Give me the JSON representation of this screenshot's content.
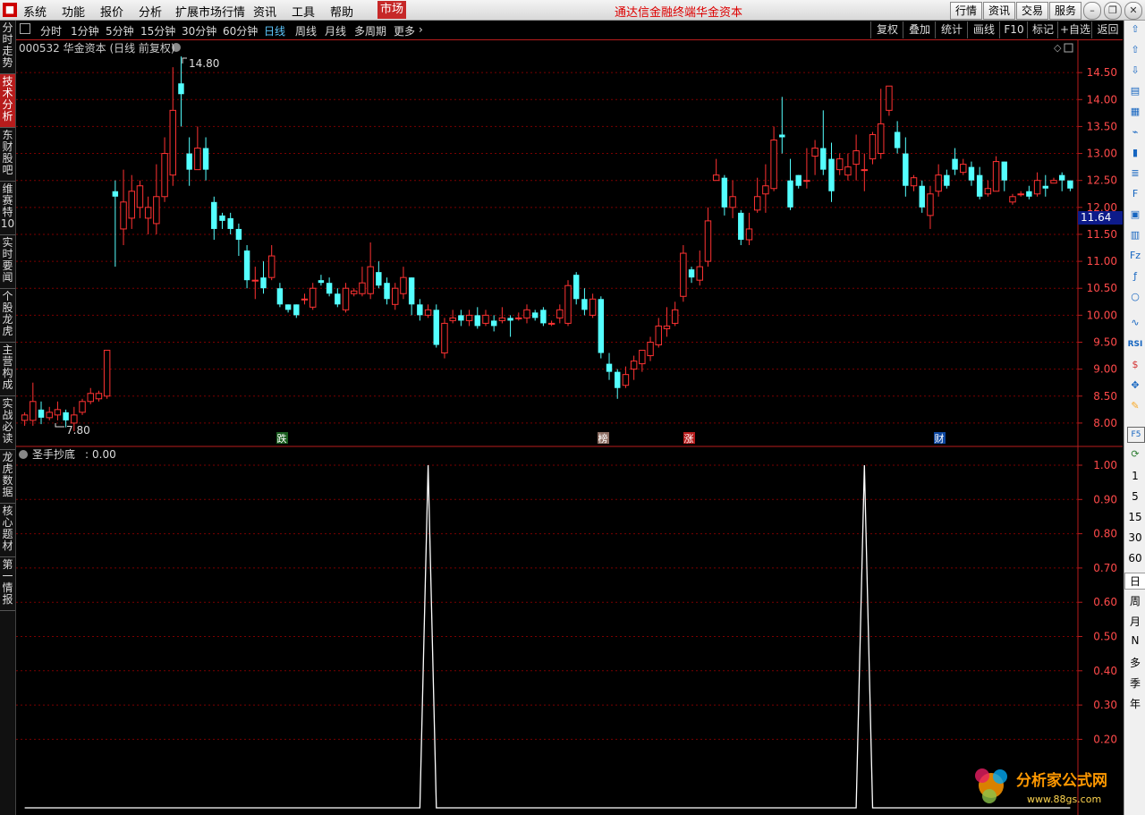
{
  "menubar": {
    "items": [
      "系统",
      "功能",
      "报价",
      "分析",
      "扩展市场行情",
      "资讯",
      "工具",
      "帮助"
    ],
    "market": "市场",
    "title1": "通达信金融终端",
    "title2": "华金资本",
    "buttons": [
      "行情",
      "资讯",
      "交易",
      "服务"
    ]
  },
  "sidebar_left": [
    "分时走势",
    "技术分析",
    "东财股吧",
    "维赛特10",
    "实时要闻",
    "个股龙虎",
    "主营构成",
    "实战必读",
    "龙虎数据",
    "核心题材",
    "第一情报"
  ],
  "sidebar_right_periods": [
    "1",
    "5",
    "15",
    "30",
    "60",
    "日",
    "周",
    "月",
    "N",
    "多",
    "季",
    "年"
  ],
  "toolbar": {
    "periods": [
      "分时",
      "1分钟",
      "5分钟",
      "15分钟",
      "30分钟",
      "60分钟",
      "日线",
      "周线",
      "月线",
      "多周期",
      "更多"
    ],
    "active_period": "日线",
    "right": [
      "复权",
      "叠加",
      "统计",
      "画线",
      "F10",
      "标记",
      "+自选",
      "返回"
    ]
  },
  "colors": {
    "up": "#ff3232",
    "down": "#54ffff",
    "grid": "#7a0000",
    "axis": "#b71c1c",
    "indicator": "#ffffff"
  },
  "watermark": {
    "name": "分析家公式网",
    "url": "www.88gs.com"
  },
  "chart_data": [
    {
      "type": "candlestick",
      "title": "000532 华金资本 (日线 前复权)",
      "y_ticks": [
        "14.50",
        "14.00",
        "13.50",
        "13.00",
        "12.50",
        "12.00",
        "11.50",
        "11.00",
        "10.50",
        "10.00",
        "9.50",
        "9.00",
        "8.50",
        "8.00"
      ],
      "ylim": [
        7.6,
        15.1
      ],
      "high_label": "14.80",
      "low_label": "7.80",
      "current_price": "11.64",
      "annotations": [
        "跌",
        "榜",
        "涨",
        "财"
      ],
      "candles": [
        [
          8.05,
          8.15,
          7.95,
          8.2
        ],
        [
          8.05,
          8.4,
          7.95,
          8.75
        ],
        [
          8.25,
          8.1,
          7.98,
          8.4
        ],
        [
          8.1,
          8.2,
          8.05,
          8.3
        ],
        [
          8.15,
          8.25,
          8.05,
          8.4
        ],
        [
          8.2,
          8.05,
          7.92,
          8.25
        ],
        [
          8.0,
          8.15,
          7.85,
          8.3
        ],
        [
          8.2,
          8.4,
          8.15,
          8.45
        ],
        [
          8.4,
          8.55,
          8.35,
          8.65
        ],
        [
          8.45,
          8.55,
          8.4,
          8.6
        ],
        [
          8.5,
          9.35,
          8.45,
          9.35
        ],
        [
          12.3,
          12.2,
          10.9,
          12.5
        ],
        [
          11.6,
          12.1,
          11.3,
          12.7
        ],
        [
          11.8,
          12.3,
          11.6,
          12.6
        ],
        [
          12.0,
          12.4,
          11.8,
          12.5
        ],
        [
          11.8,
          12.0,
          11.5,
          12.2
        ],
        [
          11.7,
          12.2,
          11.5,
          12.8
        ],
        [
          12.2,
          13.0,
          12.1,
          13.3
        ],
        [
          12.6,
          13.8,
          12.4,
          14.6
        ],
        [
          14.3,
          14.1,
          13.5,
          14.8
        ],
        [
          13.0,
          12.7,
          12.4,
          13.3
        ],
        [
          12.7,
          13.1,
          12.7,
          13.5
        ],
        [
          13.1,
          12.7,
          12.5,
          13.3
        ],
        [
          12.1,
          11.6,
          11.4,
          12.2
        ],
        [
          11.85,
          11.75,
          11.6,
          11.9
        ],
        [
          11.8,
          11.6,
          11.5,
          11.9
        ],
        [
          11.6,
          11.4,
          11.1,
          11.7
        ],
        [
          11.2,
          10.65,
          10.5,
          11.3
        ],
        [
          10.65,
          10.65,
          10.3,
          10.9
        ],
        [
          10.7,
          10.5,
          10.4,
          11.0
        ],
        [
          10.7,
          11.1,
          10.65,
          11.3
        ],
        [
          10.5,
          10.2,
          10.15,
          10.6
        ],
        [
          10.2,
          10.1,
          10.05,
          10.2
        ],
        [
          10.2,
          10.0,
          9.95,
          10.2
        ],
        [
          10.3,
          10.3,
          10.2,
          10.4
        ],
        [
          10.15,
          10.5,
          10.1,
          10.6
        ],
        [
          10.65,
          10.6,
          10.55,
          10.75
        ],
        [
          10.6,
          10.4,
          10.35,
          10.7
        ],
        [
          10.4,
          10.2,
          10.15,
          10.5
        ],
        [
          10.1,
          10.5,
          10.05,
          10.6
        ],
        [
          10.4,
          10.45,
          10.35,
          10.5
        ],
        [
          10.4,
          10.6,
          10.35,
          10.9
        ],
        [
          10.4,
          10.9,
          10.3,
          11.35
        ],
        [
          10.8,
          10.55,
          10.5,
          11.0
        ],
        [
          10.6,
          10.3,
          10.2,
          10.7
        ],
        [
          10.2,
          10.5,
          10.1,
          10.6
        ],
        [
          10.4,
          10.7,
          10.3,
          10.9
        ],
        [
          10.7,
          10.2,
          10.0,
          10.7
        ],
        [
          10.2,
          10.0,
          9.9,
          10.3
        ],
        [
          10.0,
          10.1,
          9.95,
          10.2
        ],
        [
          10.1,
          9.45,
          9.4,
          10.2
        ],
        [
          9.3,
          9.85,
          9.2,
          9.95
        ],
        [
          9.9,
          9.95,
          9.85,
          10.1
        ],
        [
          10.0,
          9.9,
          9.8,
          10.1
        ],
        [
          9.9,
          10.0,
          9.8,
          10.1
        ],
        [
          10.0,
          9.8,
          9.75,
          10.15
        ],
        [
          9.85,
          10.0,
          9.8,
          10.1
        ],
        [
          9.9,
          9.8,
          9.7,
          10.0
        ],
        [
          9.9,
          9.95,
          9.85,
          10.15
        ],
        [
          9.95,
          9.9,
          9.6,
          10.0
        ],
        [
          9.95,
          9.95,
          9.9,
          10.05
        ],
        [
          9.95,
          10.1,
          9.85,
          10.2
        ],
        [
          10.05,
          9.95,
          9.9,
          10.1
        ],
        [
          10.1,
          9.85,
          9.8,
          10.15
        ],
        [
          9.85,
          9.85,
          9.8,
          9.9
        ],
        [
          9.95,
          10.1,
          9.85,
          10.2
        ],
        [
          9.85,
          10.55,
          9.8,
          10.65
        ],
        [
          10.75,
          10.3,
          10.2,
          10.8
        ],
        [
          10.3,
          10.1,
          10.0,
          10.5
        ],
        [
          10.0,
          10.3,
          9.95,
          10.4
        ],
        [
          10.3,
          9.3,
          9.2,
          10.35
        ],
        [
          9.1,
          8.95,
          8.8,
          9.3
        ],
        [
          8.95,
          8.65,
          8.45,
          9.0
        ],
        [
          8.7,
          8.9,
          8.65,
          9.05
        ],
        [
          9.0,
          9.15,
          8.8,
          9.25
        ],
        [
          9.1,
          9.35,
          8.95,
          9.35
        ],
        [
          9.25,
          9.5,
          9.15,
          9.6
        ],
        [
          9.45,
          9.8,
          9.4,
          9.95
        ],
        [
          9.75,
          9.8,
          9.6,
          10.15
        ],
        [
          9.85,
          10.1,
          9.8,
          10.25
        ],
        [
          10.35,
          11.15,
          10.25,
          11.3
        ],
        [
          10.85,
          10.7,
          10.6,
          10.9
        ],
        [
          10.65,
          10.9,
          10.55,
          11.2
        ],
        [
          11.0,
          11.75,
          10.9,
          12.0
        ],
        [
          12.5,
          12.6,
          12.5,
          12.9
        ],
        [
          12.55,
          12.0,
          11.85,
          12.6
        ],
        [
          12.0,
          12.2,
          11.8,
          12.5
        ],
        [
          11.9,
          11.4,
          11.3,
          11.95
        ],
        [
          11.4,
          11.6,
          11.3,
          11.9
        ],
        [
          11.95,
          12.2,
          11.9,
          12.55
        ],
        [
          12.25,
          12.4,
          11.9,
          12.8
        ],
        [
          12.35,
          13.25,
          12.3,
          13.5
        ],
        [
          13.35,
          13.3,
          13.0,
          14.05
        ],
        [
          12.5,
          12.0,
          11.95,
          12.9
        ],
        [
          12.6,
          12.4,
          12.35,
          12.6
        ],
        [
          12.5,
          12.5,
          12.35,
          13.1
        ],
        [
          12.95,
          13.1,
          12.6,
          13.25
        ],
        [
          13.1,
          12.7,
          12.6,
          13.8
        ],
        [
          12.9,
          12.3,
          12.1,
          13.2
        ],
        [
          12.7,
          12.9,
          12.6,
          13.0
        ],
        [
          12.6,
          12.75,
          12.5,
          13.0
        ],
        [
          12.8,
          13.05,
          12.5,
          13.35
        ],
        [
          12.7,
          12.7,
          12.3,
          13.0
        ],
        [
          12.9,
          13.35,
          12.8,
          13.4
        ],
        [
          13.0,
          13.55,
          12.9,
          14.2
        ],
        [
          13.8,
          14.25,
          13.7,
          14.25
        ],
        [
          13.4,
          13.1,
          13.0,
          13.6
        ],
        [
          13.0,
          12.4,
          12.2,
          13.3
        ],
        [
          12.4,
          12.55,
          12.3,
          12.6
        ],
        [
          12.4,
          12.0,
          11.9,
          12.5
        ],
        [
          11.85,
          12.25,
          11.6,
          12.4
        ],
        [
          12.3,
          12.6,
          12.2,
          12.8
        ],
        [
          12.6,
          12.4,
          12.35,
          12.7
        ],
        [
          12.9,
          12.7,
          12.6,
          13.1
        ],
        [
          12.65,
          12.8,
          12.6,
          12.9
        ],
        [
          12.75,
          12.5,
          12.4,
          12.85
        ],
        [
          12.6,
          12.2,
          12.15,
          12.75
        ],
        [
          12.25,
          12.35,
          12.2,
          12.5
        ],
        [
          12.3,
          12.85,
          12.3,
          12.95
        ],
        [
          12.85,
          12.5,
          12.3,
          12.85
        ],
        [
          12.1,
          12.2,
          12.05,
          12.25
        ],
        [
          12.25,
          12.25,
          12.2,
          12.3
        ],
        [
          12.3,
          12.2,
          12.15,
          12.4
        ],
        [
          12.25,
          12.5,
          12.2,
          12.65
        ],
        [
          12.4,
          12.35,
          12.2,
          12.6
        ],
        [
          12.45,
          12.5,
          12.45,
          12.55
        ],
        [
          12.6,
          12.5,
          12.3,
          12.65
        ],
        [
          12.5,
          12.35,
          12.3,
          12.5
        ]
      ]
    },
    {
      "type": "line",
      "title": "圣手抄底",
      "value_label": "0.00",
      "y_ticks": [
        "1.00",
        "0.90",
        "0.80",
        "0.70",
        "0.60",
        "0.50",
        "0.40",
        "0.30",
        "0.20"
      ],
      "ylim": [
        0,
        1.0
      ],
      "signal_indices": [
        49,
        102
      ],
      "values_default": 0
    }
  ]
}
